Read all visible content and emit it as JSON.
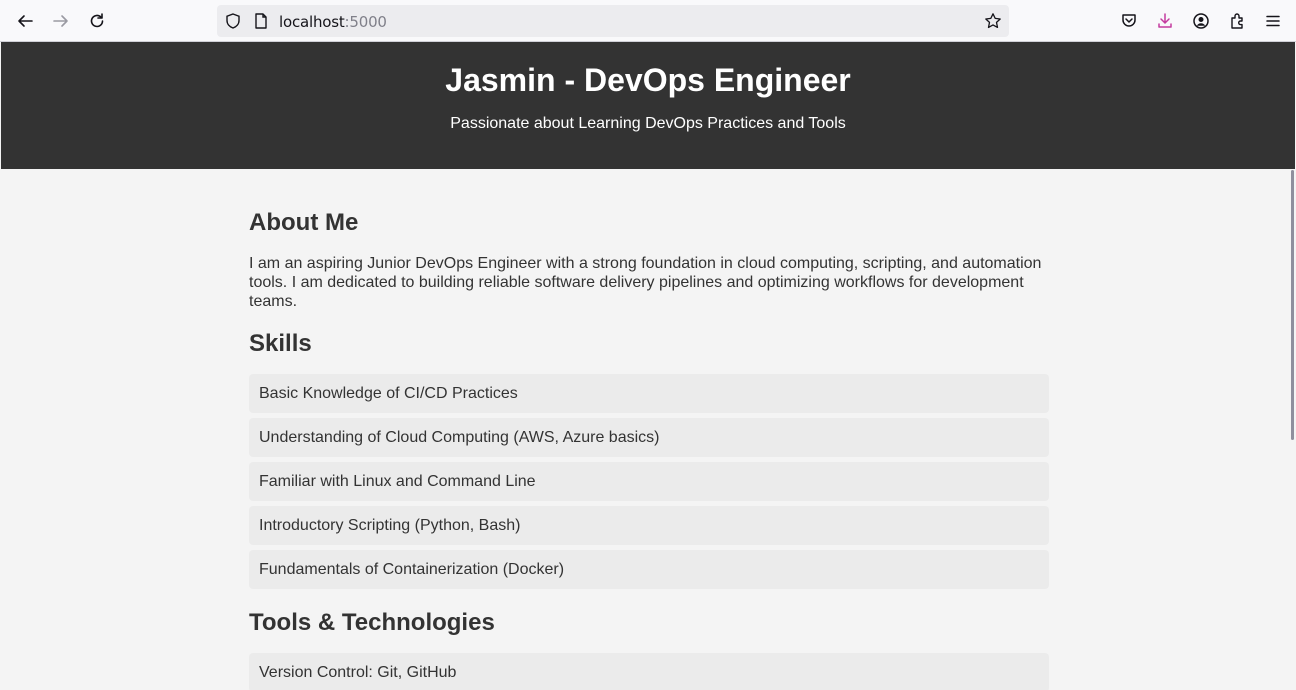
{
  "browser": {
    "url_host": "localhost",
    "url_port": ":5000"
  },
  "header": {
    "title": "Jasmin - DevOps Engineer",
    "subtitle": "Passionate about Learning DevOps Practices and Tools"
  },
  "about": {
    "heading": "About Me",
    "text": "I am an aspiring Junior DevOps Engineer with a strong foundation in cloud computing, scripting, and automation tools. I am dedicated to building reliable software delivery pipelines and optimizing workflows for development teams."
  },
  "skills": {
    "heading": "Skills",
    "items": [
      "Basic Knowledge of CI/CD Practices",
      "Understanding of Cloud Computing (AWS, Azure basics)",
      "Familiar with Linux and Command Line",
      "Introductory Scripting (Python, Bash)",
      "Fundamentals of Containerization (Docker)"
    ]
  },
  "tools": {
    "heading": "Tools & Technologies",
    "items": [
      "Version Control: Git, GitHub"
    ]
  }
}
